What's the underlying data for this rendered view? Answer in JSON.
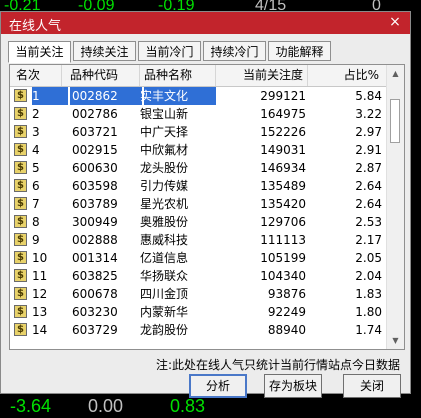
{
  "background": {
    "top_values": [
      "-0.21",
      "-0.09",
      "-0.19",
      "4/15",
      "0"
    ],
    "bottom_values": [
      "-3.64",
      "0.00",
      "0.83"
    ]
  },
  "dialog": {
    "title": "在线人气",
    "close_symbol": "×",
    "tabs": [
      "当前关注",
      "持续关注",
      "当前冷门",
      "持续冷门",
      "功能解释"
    ],
    "active_tab": 0,
    "columns": [
      "名次",
      "品种代码",
      "品种名称",
      "当前关注度",
      "占比%"
    ],
    "rows": [
      {
        "rank": "1",
        "code": "002862",
        "name": "实丰文化",
        "value": "299121",
        "pct": "5.84"
      },
      {
        "rank": "2",
        "code": "002786",
        "name": "银宝山新",
        "value": "164975",
        "pct": "3.22"
      },
      {
        "rank": "3",
        "code": "603721",
        "name": "中广天择",
        "value": "152226",
        "pct": "2.97"
      },
      {
        "rank": "4",
        "code": "002915",
        "name": "中欣氟材",
        "value": "149031",
        "pct": "2.91"
      },
      {
        "rank": "5",
        "code": "600630",
        "name": "龙头股份",
        "value": "146934",
        "pct": "2.87"
      },
      {
        "rank": "6",
        "code": "603598",
        "name": "引力传媒",
        "value": "135489",
        "pct": "2.64"
      },
      {
        "rank": "7",
        "code": "603789",
        "name": "星光农机",
        "value": "135420",
        "pct": "2.64"
      },
      {
        "rank": "8",
        "code": "300949",
        "name": "奥雅股份",
        "value": "129706",
        "pct": "2.53"
      },
      {
        "rank": "9",
        "code": "002888",
        "name": "惠威科技",
        "value": "111113",
        "pct": "2.17"
      },
      {
        "rank": "10",
        "code": "001314",
        "name": "亿道信息",
        "value": "105199",
        "pct": "2.05"
      },
      {
        "rank": "11",
        "code": "603825",
        "name": "华扬联众",
        "value": "104340",
        "pct": "2.04"
      },
      {
        "rank": "12",
        "code": "600678",
        "name": "四川金顶",
        "value": "93876",
        "pct": "1.83"
      },
      {
        "rank": "13",
        "code": "603230",
        "name": "内蒙新华",
        "value": "92249",
        "pct": "1.80"
      },
      {
        "rank": "14",
        "code": "603729",
        "name": "龙韵股份",
        "value": "88940",
        "pct": "1.74"
      }
    ],
    "rank_icon_glyph": "$",
    "note": "注:此处在线人气只统计当前行情站点今日数据",
    "buttons": {
      "analyze": "分析",
      "save_block": "存为板块",
      "close": "关闭"
    }
  },
  "colors": {
    "titlebar": "#c2242c",
    "selection": "#2f6fd6"
  }
}
